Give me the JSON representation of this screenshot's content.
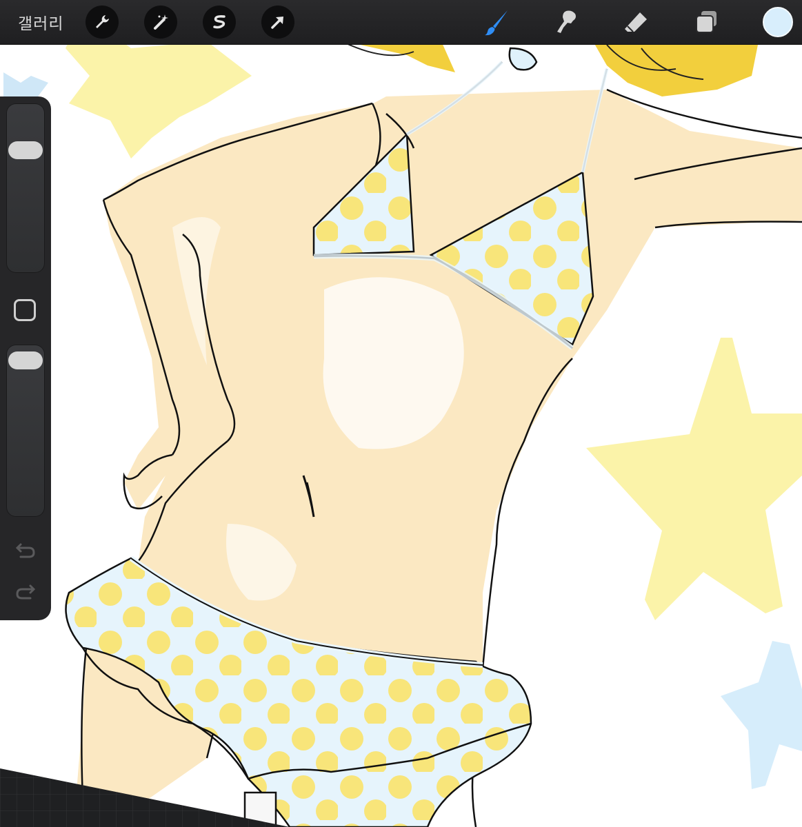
{
  "toolbar": {
    "gallery_label": "갤러리",
    "left_tools": [
      "wrench-icon",
      "magic-wand-icon",
      "selection-icon",
      "move-arrow-icon"
    ],
    "right_tools": [
      "brush-icon",
      "smudge-icon",
      "eraser-icon",
      "layers-icon"
    ],
    "active_tool": "brush-icon",
    "active_color": "#d8eefc"
  },
  "sidebar": {
    "controls": [
      "brush-size-slider",
      "modify-button",
      "opacity-slider",
      "undo-button",
      "redo-button"
    ]
  },
  "colors": {
    "star_yellow": "#fbf3a9",
    "star_blue": "#d6edfb",
    "skin": "#fbe8c2",
    "polka_dot": "#f8e57a",
    "hair": "#f2cf3d",
    "line": "#111111"
  }
}
